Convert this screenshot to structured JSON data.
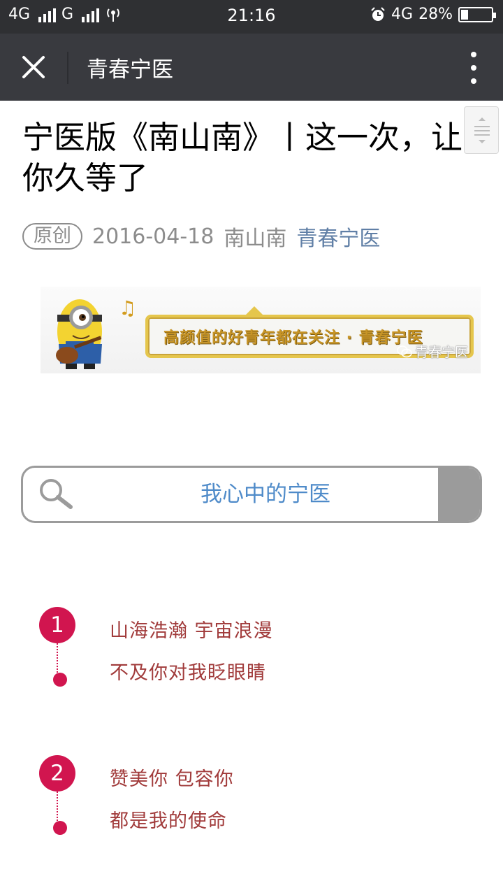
{
  "status_bar": {
    "network_left": "4G",
    "network_mid": "G",
    "time": "21:16",
    "network_right": "4G",
    "battery_percent": "28%"
  },
  "nav": {
    "title": "青春宁医"
  },
  "article": {
    "title": "宁医版《南山南》丨这一次，让你久等了",
    "badge": "原创",
    "date": "2016-04-18",
    "author": "南山南",
    "account": "青春宁医"
  },
  "banner": {
    "text": "高颜值的好青年都在关注 · 青春宁医",
    "watermark": "青春宁医"
  },
  "search": {
    "text": "我心中的宁医"
  },
  "items": [
    {
      "number": "1",
      "line1": "山海浩瀚 宇宙浪漫",
      "line2": "不及你对我眨眼睛"
    },
    {
      "number": "2",
      "line1": "赞美你 包容你",
      "line2": "都是我的使命"
    }
  ],
  "colors": {
    "accent": "#d1154f",
    "lyric": "#a13b3b",
    "link": "#607fa6",
    "nav_bg": "#393a3f"
  }
}
